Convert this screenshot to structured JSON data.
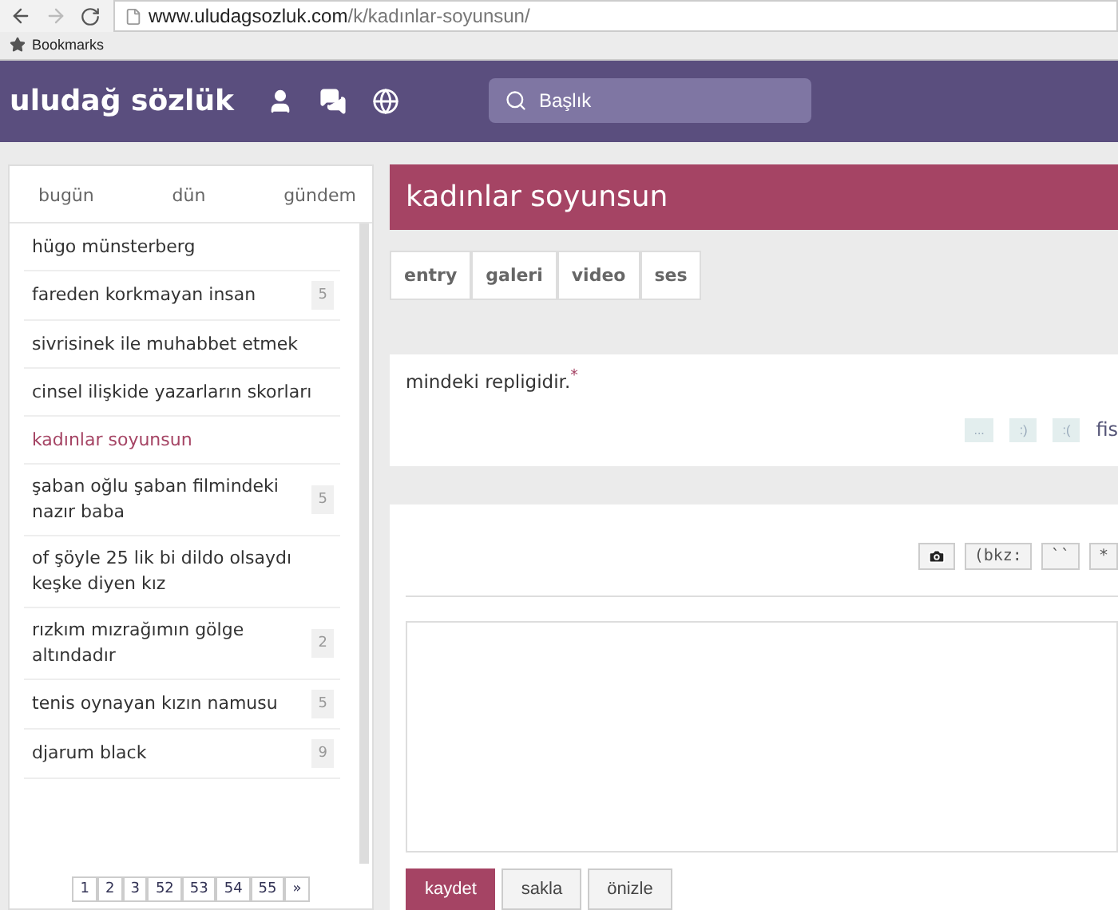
{
  "browser": {
    "url_host": "www.uludagsozluk.com",
    "url_path": "/k/kadınlar-soyunsun/",
    "bookmarks": "Bookmarks"
  },
  "header": {
    "logo": "uludağ sözlük",
    "search": {
      "placeholder": "Başlık"
    }
  },
  "sidebar": {
    "tabs": [
      {
        "label": "bugün"
      },
      {
        "label": "dün"
      },
      {
        "label": "gündem"
      }
    ],
    "items": [
      {
        "title": "hügo münsterberg",
        "selected": false
      },
      {
        "title": "fareden korkmayan insan",
        "count": "5",
        "selected": false
      },
      {
        "title": "sivrisinek ile muhabbet etmek",
        "selected": false
      },
      {
        "title": "cinsel ilişkide yazarların skorları",
        "selected": false
      },
      {
        "title": "kadınlar soyunsun",
        "selected": true
      },
      {
        "title": "şaban oğlu şaban filmindeki nazır baba",
        "count": "5",
        "selected": false
      },
      {
        "title": "of şöyle 25 lik bi dildo olsaydı keşke diyen kız",
        "selected": false
      },
      {
        "title": "rızkım mızrağımın gölge altındadır",
        "count": "2",
        "selected": false
      },
      {
        "title": "tenis oynayan kızın namusu",
        "count": "5",
        "selected": false
      },
      {
        "title": "djarum black",
        "count": "9",
        "selected": false
      }
    ],
    "pages": [
      "1",
      "2",
      "3",
      "52",
      "53",
      "54",
      "55",
      "»"
    ]
  },
  "topic": {
    "title": "kadınlar soyunsun",
    "tabs": [
      "entry",
      "galeri",
      "video",
      "ses"
    ],
    "entry": {
      "text": "mindeki repligidir.$^{*}$",
      "actions": [
        "...",
        ":)",
        ":("
      ],
      "author": "fis"
    },
    "editor": {
      "tools": [
        "(bkz:",
        "``",
        "*"
      ],
      "buttons": [
        {
          "label": "kaydet",
          "kind": "primary"
        },
        {
          "label": "sakla",
          "kind": "plain"
        },
        {
          "label": "önizle",
          "kind": "plain"
        }
      ]
    }
  }
}
